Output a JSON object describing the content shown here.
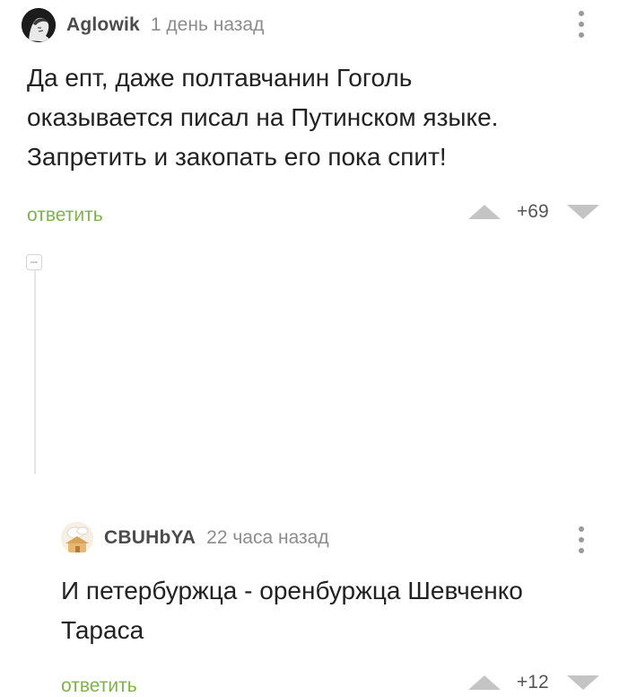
{
  "comments": [
    {
      "username": "Aglowik",
      "time": "1 день назад",
      "lines": [
        "Да епт, даже полтавчанин Гоголь",
        "оказывается писал на Путинском языке.",
        "Запретить и закопать его пока спит!"
      ],
      "reply_label": "ответить",
      "score": "+69"
    },
    {
      "username": "CBUHbYA",
      "time": "22 часа назад",
      "lines": [
        "И петербуржца - оренбуржца Шевченко",
        "Тараса"
      ],
      "reply_label": "ответить",
      "score": "+12"
    }
  ],
  "colors": {
    "accent_green": "#7fb34a",
    "muted": "#8c8c8c",
    "vote_gray": "#c4c4c4"
  },
  "icons": {
    "more": "more-vertical-icon",
    "upvote": "upvote-icon",
    "downvote": "downvote-icon",
    "collapse": "collapse-thread-icon"
  }
}
